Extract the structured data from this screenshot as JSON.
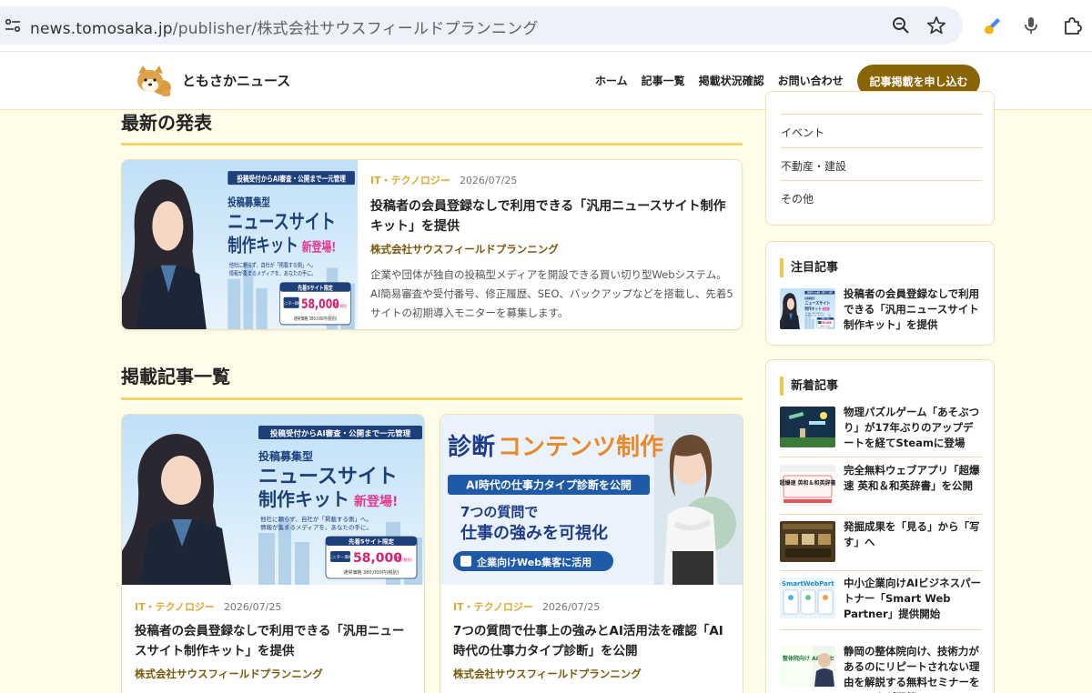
{
  "browser": {
    "url_domain": "news.tomosaka.jp",
    "url_path": "/publisher/株式会社サウスフィールドプランニング"
  },
  "site": {
    "name": "ともさかニュース",
    "nav": [
      "ホーム",
      "記事一覧",
      "掲載状況確認",
      "お問い合わせ"
    ],
    "cta": "記事掲載を申し込む"
  },
  "main": {
    "latest_heading": "最新の発表",
    "featured": {
      "category": "IT・テクノロジー",
      "date": "2026/07/25",
      "title": "投稿者の会員登録なしで利用できる「汎用ニュースサイト制作キット」を提供",
      "company": "株式会社サウスフィールドプランニング",
      "description": "企業や団体が独自の投稿型メディアを開設できる買い切り型Webシステム。AI簡易審査や受付番号、修正履歴、SEO、バックアップなどを搭載し、先着5サイトの初期導入モニターを募集します。",
      "thumb": {
        "banner": "投稿受付からAI審査・公開まで一元管理",
        "kicker": "投稿募集型",
        "line1": "ニュースサイト",
        "line2": "制作キット",
        "badge": "新登場!",
        "sub1": "他社に頼らず、自社が「掲載する側」へ。",
        "sub2": "情報が集まるメディアを、あなたの手に。",
        "offer_label": "先着5サイト限定",
        "offer_tag": "モニター価格",
        "price": "58,000",
        "price_unit": "円",
        "price_note": "(税別)",
        "regular": "通常価格 380,000円(税別)"
      }
    },
    "list_heading": "掲載記事一覧",
    "articles": [
      {
        "category": "IT・テクノロジー",
        "date": "2026/07/25",
        "title": "投稿者の会員登録なしで利用できる「汎用ニュースサイト制作キット」を提供",
        "company": "株式会社サウスフィールドプランニング"
      },
      {
        "category": "IT・テクノロジー",
        "date": "2026/07/25",
        "title": "7つの質問で仕事上の強みとAI活用法を確認「AI時代の仕事力タイプ診断」を公開",
        "company": "株式会社サウスフィールドプランニング",
        "thumb": {
          "headline_a": "診断",
          "headline_b": "コンテンツ制作",
          "band": "AI時代の仕事力タイプ診断を公開",
          "q_line1": "7つの質問で",
          "q_line2": "仕事の強みを可視化",
          "pill": "企業向けWeb集客に活用"
        }
      }
    ]
  },
  "sidebar": {
    "categories": [
      "イベント",
      "不動産・建設",
      "その他"
    ],
    "featured_heading": "注目記事",
    "featured_items": [
      {
        "title": "投稿者の会員登録なしで利用できる「汎用ニュースサイト制作キット」を提供"
      }
    ],
    "new_heading": "新着記事",
    "new_items": [
      {
        "title": "物理パズルゲーム「あそぶつり」が17年ぶりのアップデートを経てSteamに登場"
      },
      {
        "title": "完全無料ウェブアプリ「超爆速 英和＆和英辞書」を公開",
        "thumb_text": "超爆速 英和＆和英辞書"
      },
      {
        "title": "発掘成果を「見る」から「写す」へ"
      },
      {
        "title": "中小企業向けAIビジネスパートナー「Smart Web Partner」提供開始",
        "thumb_text": "SmartWebPart"
      },
      {
        "title": "静岡の整体院向け、技術力があるのにリピートされない理由を解説する無料セミナーをエルツクが開催",
        "thumb_text": "整体院向け AI活用セミナー"
      }
    ]
  },
  "colors": {
    "page_bg": "#fffcea",
    "accent_gold": "#8a6508",
    "category": "#e0a82e",
    "rule_yellow": "#f3d36b"
  }
}
